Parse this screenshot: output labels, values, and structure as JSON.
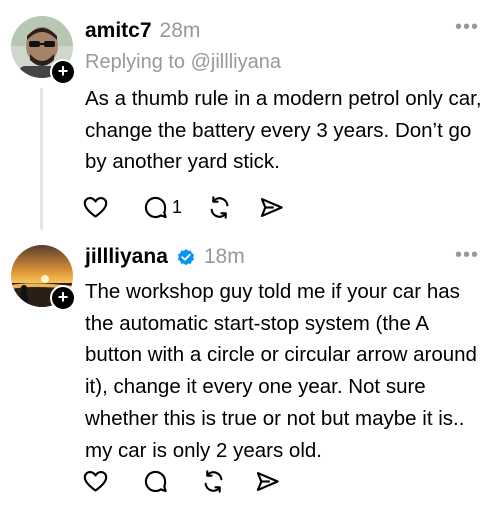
{
  "posts": [
    {
      "username": "amitc7",
      "time": "28m",
      "reply_to": "Replying to @jillliyana",
      "text": "As a thumb rule in a modern petrol only car, change the battery every 3 years. Don’t go by another yard stick.",
      "reply_count": "1"
    },
    {
      "username": "jillliyana",
      "time": "18m",
      "text": "The workshop guy told me if your car has the automatic start-stop system (the A button with a circle or circular arrow around it), change it every one year. Not sure whether this is true or not but maybe it is.. my car is only 2 years old.",
      "reply_count": ""
    }
  ],
  "icons": {
    "like": "heart-icon",
    "reply": "comment-icon",
    "repost": "repost-icon",
    "share": "send-icon",
    "more": "more-icon",
    "follow": "plus-icon",
    "verified": "verified-badge-icon"
  },
  "colors": {
    "verified": "#0095f6",
    "muted": "#999999"
  }
}
